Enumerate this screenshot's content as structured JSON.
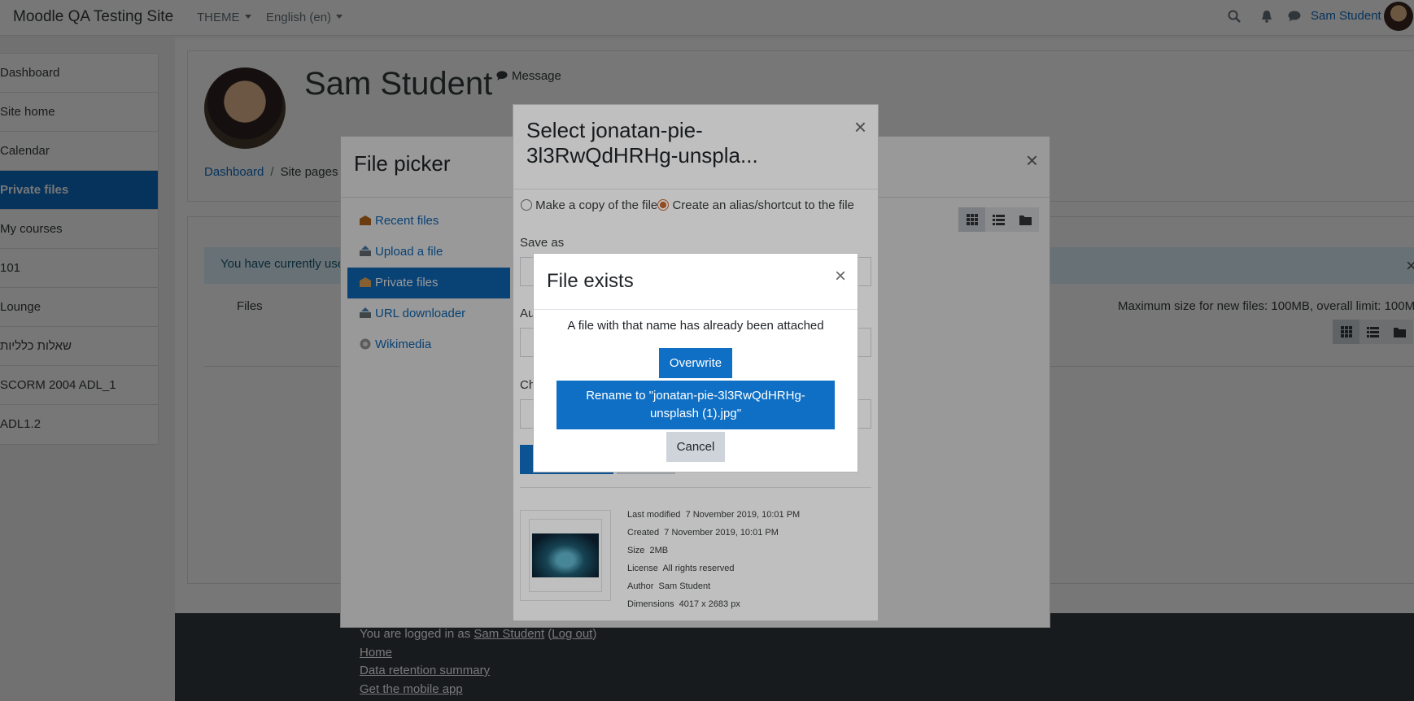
{
  "navbar": {
    "site_name": "Moodle QA Testing Site",
    "theme_menu": "THEME",
    "language_menu": "English (en)",
    "user_name": "Sam Student"
  },
  "drawer": {
    "items": [
      {
        "label": "Dashboard",
        "active": false
      },
      {
        "label": "Site home",
        "active": false
      },
      {
        "label": "Calendar",
        "active": false
      },
      {
        "label": "Private files",
        "active": true
      },
      {
        "label": "My courses",
        "active": false
      },
      {
        "label": "101",
        "active": false
      },
      {
        "label": "Lounge",
        "active": false
      },
      {
        "label": "שאלות כלליות",
        "active": false
      },
      {
        "label": "SCORM 2004 ADL_1",
        "active": false
      },
      {
        "label": "ADL1.2",
        "active": false
      }
    ]
  },
  "header": {
    "title": "Sam Student",
    "message_link": "Message",
    "breadcrumb": [
      "Dashboard",
      "Site pages"
    ]
  },
  "main": {
    "alert_text": "You have currently use",
    "files_label": "Files",
    "max_size_text": "Maximum size for new files: 100MB, overall limit: 100MB"
  },
  "footer": {
    "logged_in_prefix": "You are logged in as",
    "logged_in_user": "Sam Student",
    "logout": "Log out",
    "links": [
      "Home",
      "Data retention summary",
      "Get the mobile app"
    ]
  },
  "file_picker": {
    "title": "File picker",
    "close": "×",
    "repositories": [
      {
        "label": "Recent files",
        "active": false
      },
      {
        "label": "Upload a file",
        "active": false
      },
      {
        "label": "Private files",
        "active": true
      },
      {
        "label": "URL downloader",
        "active": false
      },
      {
        "label": "Wikimedia",
        "active": false
      }
    ]
  },
  "select_dialog": {
    "title": "Select jonatan-pie-3l3RwQdHRHg-unspla...",
    "close": "×",
    "option_copy": "Make a copy of the file",
    "option_alias": "Create an alias/shortcut to the file",
    "selected_option": "alias",
    "save_as_label": "Save as",
    "author_label": "Au",
    "choose_label": "Ch",
    "meta": [
      {
        "label": "Last modified",
        "value": "7 November 2019, 10:01 PM"
      },
      {
        "label": "Created",
        "value": "7 November 2019, 10:01 PM"
      },
      {
        "label": "Size",
        "value": "2MB"
      },
      {
        "label": "License",
        "value": "All rights reserved"
      },
      {
        "label": "Author",
        "value": "Sam Student"
      },
      {
        "label": "Dimensions",
        "value": "4017 x 2683 px"
      }
    ]
  },
  "file_exists_dialog": {
    "title": "File exists",
    "close": "×",
    "message": "A file with that name has already been attached",
    "overwrite": "Overwrite",
    "rename": "Rename to \"jonatan-pie-3l3RwQdHRHg-unsplash (1).jpg\"",
    "cancel": "Cancel"
  },
  "colors": {
    "primary": "#0f6fc5",
    "footer_bg": "#343a40",
    "alert_bg": "#dff2fb"
  }
}
